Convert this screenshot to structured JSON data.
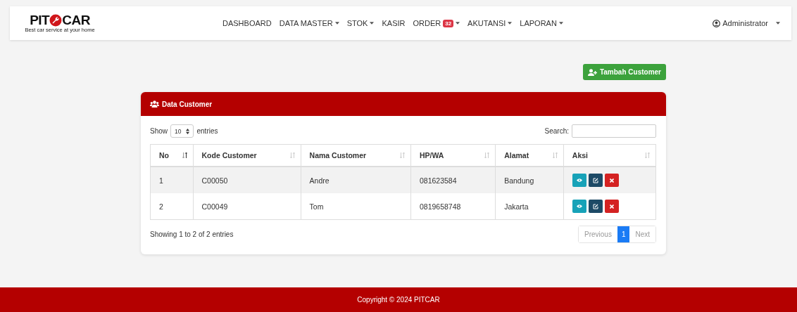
{
  "navbar": {
    "logo": {
      "left": "PIT",
      "right": "CAR",
      "tagline": "Best car service at your home"
    },
    "menu": [
      {
        "label": "DASHBOARD",
        "dropdown": false
      },
      {
        "label": "DATA MASTER",
        "dropdown": true
      },
      {
        "label": "STOK",
        "dropdown": true
      },
      {
        "label": "KASIR",
        "dropdown": false
      },
      {
        "label": "ORDER",
        "dropdown": true,
        "badge": "32"
      },
      {
        "label": "AKUTANSI",
        "dropdown": true
      },
      {
        "label": "LAPORAN",
        "dropdown": true
      }
    ],
    "user": {
      "label": "Administrator",
      "dropdown": true
    }
  },
  "add_button": "Tambah Customer",
  "card": {
    "title": "Data Customer",
    "length": {
      "before": "Show",
      "value": "10",
      "after": "entries"
    },
    "search_label": "Search:",
    "columns": [
      {
        "label": "No",
        "sorted": true
      },
      {
        "label": "Kode Customer",
        "sorted": false
      },
      {
        "label": "Nama Customer",
        "sorted": false
      },
      {
        "label": "HP/WA",
        "sorted": false
      },
      {
        "label": "Alamat",
        "sorted": false
      },
      {
        "label": "Aksi",
        "sorted": false
      }
    ],
    "rows": [
      [
        "1",
        "C00050",
        "Andre",
        "081623584",
        "Bandung"
      ],
      [
        "2",
        "C00049",
        "Tom",
        "0819658748",
        "Jakarta"
      ]
    ],
    "info": "Showing 1 to 2 of 2 entries",
    "pagination": [
      {
        "label": "Previous",
        "kind": "prev",
        "selected": false,
        "disabled": true
      },
      {
        "label": "1",
        "kind": "page",
        "selected": true,
        "disabled": false
      },
      {
        "label": "Next",
        "kind": "next",
        "selected": false,
        "disabled": true
      }
    ]
  },
  "footer": "Copyright © 2024 PITCAR"
}
